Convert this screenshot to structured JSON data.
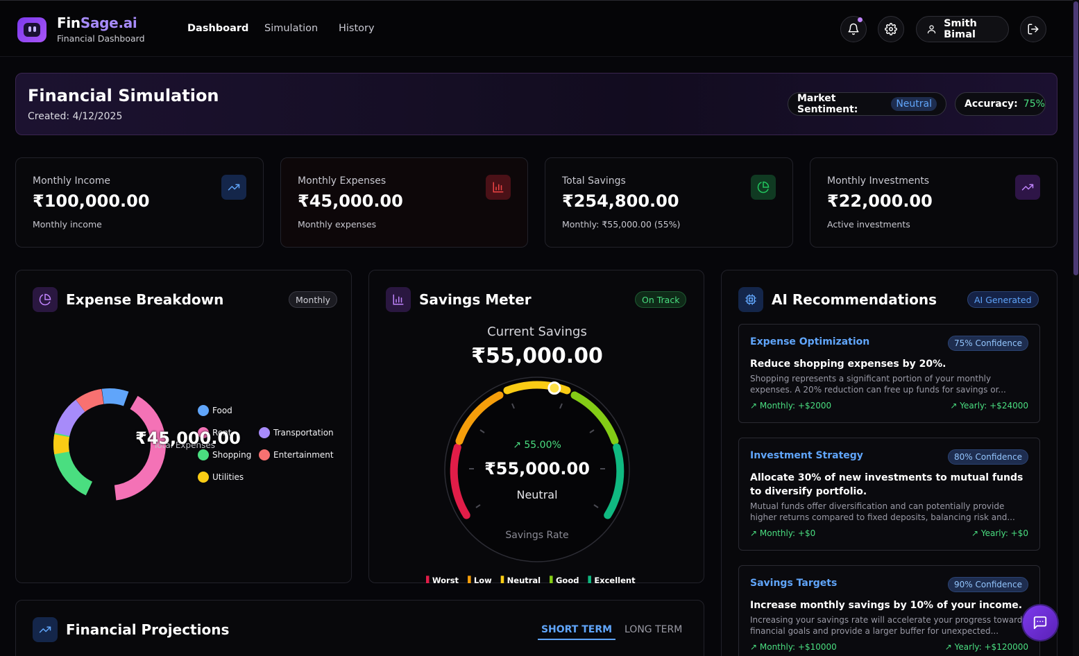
{
  "header": {
    "brand_prefix": "Fin",
    "brand_accent": "Sage.ai",
    "brand_sub": "Financial Dashboard",
    "nav": [
      "Dashboard",
      "Simulation",
      "History"
    ],
    "user_name": "Smith Bimal",
    "icons": [
      "bell-icon",
      "gear-icon",
      "user-icon",
      "logout-icon"
    ]
  },
  "banner": {
    "title": "Financial Simulation",
    "created": "Created: 4/12/2025",
    "sentiment_label": "Market Sentiment:",
    "sentiment_value": "Neutral",
    "accuracy_label": "Accuracy:",
    "accuracy_value": "75%"
  },
  "stats": [
    {
      "label": "Monthly Income",
      "value": "₹100,000.00",
      "sub": "Monthly income",
      "icon": "trend-up-icon",
      "color": "#60a5fa"
    },
    {
      "label": "Monthly Expenses",
      "value": "₹45,000.00",
      "sub": "Monthly expenses",
      "icon": "bar-chart-icon",
      "color": "#ef4444"
    },
    {
      "label": "Total Savings",
      "value": "₹254,800.00",
      "sub": "Monthly: ₹55,000.00 (55%)",
      "icon": "pie-chart-icon",
      "color": "#22c55e"
    },
    {
      "label": "Monthly Investments",
      "value": "₹22,000.00",
      "sub": "Active investments",
      "icon": "trend-up-icon",
      "color": "#a855f7"
    }
  ],
  "expense": {
    "title": "Expense Breakdown",
    "tag": "Monthly",
    "center_value": "₹45,000.00",
    "center_label": "Total Expenses",
    "legend": [
      {
        "label": "Food",
        "color": "#60a5fa"
      },
      {
        "label": "Rent",
        "color": "#f472b6"
      },
      {
        "label": "Transportation",
        "color": "#a78bfa"
      },
      {
        "label": "Shopping",
        "color": "#4ade80"
      },
      {
        "label": "Entertainment",
        "color": "#f87171"
      },
      {
        "label": "Utilities",
        "color": "#facc15"
      }
    ]
  },
  "savings": {
    "title": "Savings Meter",
    "tag": "On Track",
    "current_label": "Current Savings",
    "current_value": "₹55,000.00",
    "rate": "55.00%",
    "value": "₹55,000.00",
    "status": "Neutral",
    "rate_label": "Savings Rate",
    "rate_fraction": 0.55,
    "legend": [
      {
        "label": "Worst",
        "color": "#e11d48"
      },
      {
        "label": "Low",
        "color": "#f59e0b"
      },
      {
        "label": "Neutral",
        "color": "#facc15"
      },
      {
        "label": "Good",
        "color": "#84cc16"
      },
      {
        "label": "Excellent",
        "color": "#10b981"
      }
    ]
  },
  "recs": {
    "title": "AI Recommendations",
    "tag": "AI Generated",
    "items": [
      {
        "category": "Expense Optimization",
        "confidence": "75% Confidence",
        "title": "Reduce shopping expenses by 20%.",
        "body": "Shopping represents a significant portion of your monthly expenses. A 20% reduction can free up funds for savings or...",
        "monthly": "Monthly: +$2000",
        "yearly": "Yearly: +$24000"
      },
      {
        "category": "Investment Strategy",
        "confidence": "80% Confidence",
        "title": "Allocate 30% of new investments to mutual funds to diversify portfolio.",
        "body": "Mutual funds offer diversification and can potentially provide higher returns compared to fixed deposits, balancing risk and...",
        "monthly": "Monthly: +$0",
        "yearly": "Yearly: +$0"
      },
      {
        "category": "Savings Targets",
        "confidence": "90% Confidence",
        "title": "Increase monthly savings by 10% of your income.",
        "body": "Increasing your savings rate will accelerate your progress towards financial goals and provide a larger buffer for unexpected...",
        "monthly": "Monthly: +$10000",
        "yearly": "Yearly: +$120000"
      }
    ]
  },
  "projections": {
    "title": "Financial Projections",
    "tab_short": "SHORT TERM",
    "tab_long": "LONG TERM"
  }
}
